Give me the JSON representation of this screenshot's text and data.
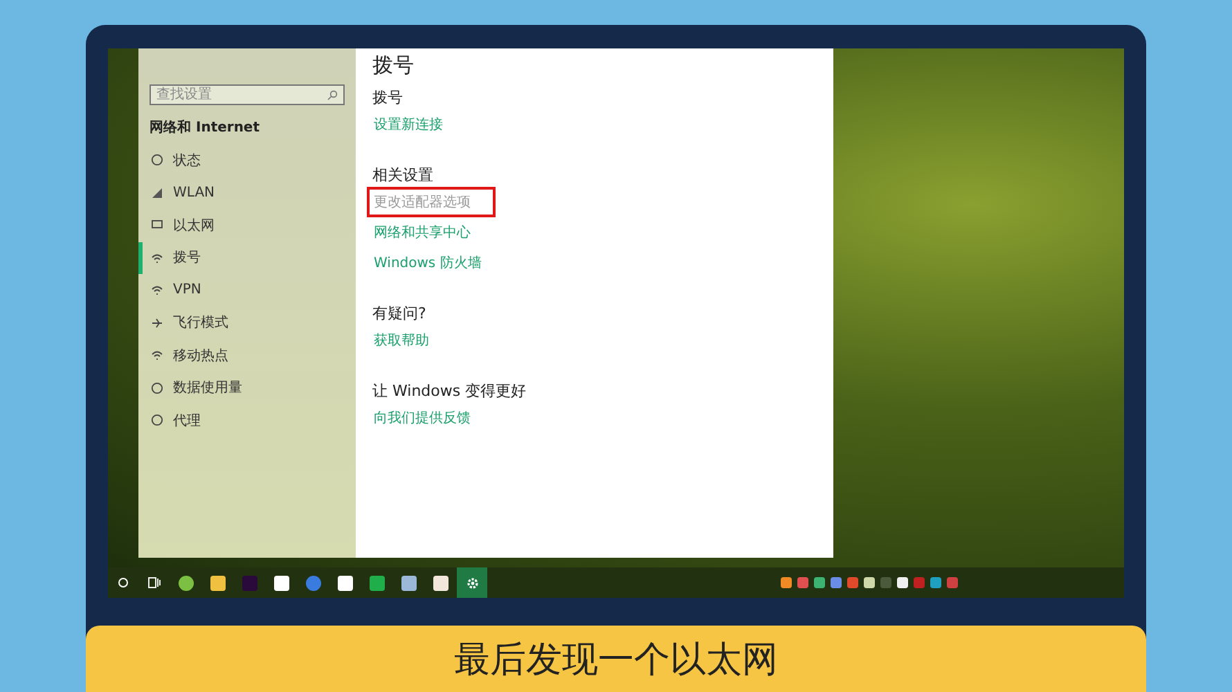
{
  "settings_window": {
    "search": {
      "placeholder": "查找设置"
    },
    "sidebar": {
      "heading": "网络和 Internet",
      "items": [
        {
          "label": "状态",
          "selected": false
        },
        {
          "label": "WLAN",
          "selected": false
        },
        {
          "label": "以太网",
          "selected": false
        },
        {
          "label": "拨号",
          "selected": true
        },
        {
          "label": "VPN",
          "selected": false
        },
        {
          "label": "飞行模式",
          "selected": false
        },
        {
          "label": "移动热点",
          "selected": false
        },
        {
          "label": "数据使用量",
          "selected": false
        },
        {
          "label": "代理",
          "selected": false
        }
      ]
    },
    "main": {
      "title": "拨号",
      "sections": [
        {
          "heading": "拨号",
          "links": [
            {
              "text": "设置新连接",
              "highlighted": false
            }
          ]
        },
        {
          "heading": "相关设置",
          "links": [
            {
              "text": "更改适配器选项",
              "highlighted": true
            },
            {
              "text": "网络和共享中心",
              "highlighted": false
            },
            {
              "text": "Windows 防火墙",
              "highlighted": false
            }
          ]
        },
        {
          "heading": "有疑问?",
          "links": [
            {
              "text": "获取帮助",
              "highlighted": false
            }
          ]
        },
        {
          "heading": "让 Windows 变得更好",
          "links": [
            {
              "text": "向我们提供反馈",
              "highlighted": false
            }
          ]
        }
      ]
    }
  },
  "taskbar": {
    "apps": [
      {
        "kind": "browser",
        "selected": false
      },
      {
        "kind": "folder",
        "selected": false
      },
      {
        "kind": "premiere",
        "selected": false
      },
      {
        "kind": "cloud",
        "selected": false
      },
      {
        "kind": "sogou",
        "selected": false
      },
      {
        "kind": "shield",
        "selected": false
      },
      {
        "kind": "sheet",
        "selected": false
      },
      {
        "kind": "notes",
        "selected": false
      },
      {
        "kind": "slides",
        "selected": false
      },
      {
        "kind": "settings",
        "selected": true
      }
    ]
  },
  "caption": "最后发现一个以太网"
}
